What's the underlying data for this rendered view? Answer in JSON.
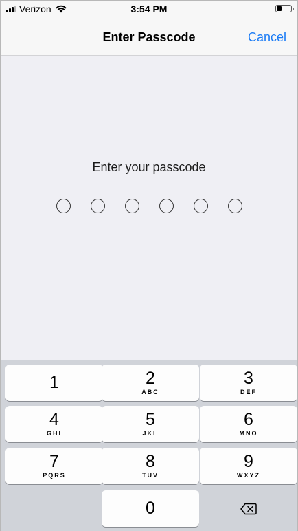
{
  "status_bar": {
    "carrier": "Verizon",
    "time": "3:54 PM",
    "battery_level": 0.35
  },
  "nav": {
    "title": "Enter Passcode",
    "cancel_label": "Cancel"
  },
  "prompt": {
    "text": "Enter your passcode",
    "digit_count": 6
  },
  "keypad": {
    "keys": [
      {
        "digit": "1",
        "letters": ""
      },
      {
        "digit": "2",
        "letters": "ABC"
      },
      {
        "digit": "3",
        "letters": "DEF"
      },
      {
        "digit": "4",
        "letters": "GHI"
      },
      {
        "digit": "5",
        "letters": "JKL"
      },
      {
        "digit": "6",
        "letters": "MNO"
      },
      {
        "digit": "7",
        "letters": "PQRS"
      },
      {
        "digit": "8",
        "letters": "TUV"
      },
      {
        "digit": "9",
        "letters": "WXYZ"
      },
      {
        "digit": "0",
        "letters": ""
      }
    ],
    "delete_icon": "backspace-icon"
  },
  "colors": {
    "accent": "#1a7bf5",
    "keypad_bg": "#d0d3d9",
    "background": "#efeff4"
  }
}
